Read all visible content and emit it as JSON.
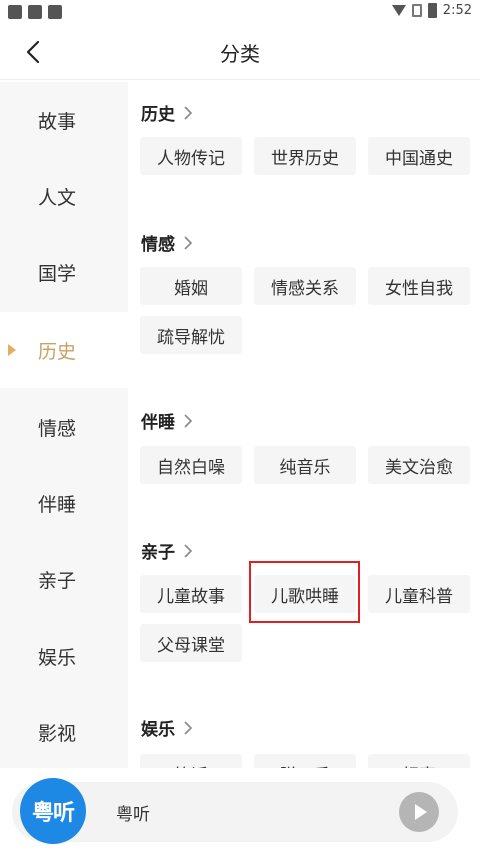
{
  "status": {
    "time": "2:52"
  },
  "header": {
    "title": "分类"
  },
  "sidebar": {
    "items": [
      {
        "label": "故事"
      },
      {
        "label": "人文"
      },
      {
        "label": "国学"
      },
      {
        "label": "历史",
        "active": true
      },
      {
        "label": "情感"
      },
      {
        "label": "伴睡"
      },
      {
        "label": "亲子"
      },
      {
        "label": "娱乐"
      },
      {
        "label": "影视"
      }
    ]
  },
  "sections": [
    {
      "title": "历史",
      "tags": [
        "人物传记",
        "世界历史",
        "中国通史"
      ]
    },
    {
      "title": "情感",
      "tags": [
        "婚姻",
        "情感关系",
        "女性自我",
        "疏导解忧"
      ]
    },
    {
      "title": "伴睡",
      "tags": [
        "自然白噪",
        "纯音乐",
        "美文治愈"
      ]
    },
    {
      "title": "亲子",
      "tags": [
        "儿童故事",
        "儿歌哄睡",
        "儿童科普",
        "父母课堂"
      ]
    },
    {
      "title": "娱乐",
      "tags": [
        "笑话",
        "脱口秀",
        "相声"
      ]
    }
  ],
  "player": {
    "logo_text": "粤听",
    "label": "粤听"
  },
  "colors": {
    "accent": "#c9a063",
    "marker": "#e0b060",
    "highlight": "#e02020",
    "logo": "#1e88e5"
  }
}
